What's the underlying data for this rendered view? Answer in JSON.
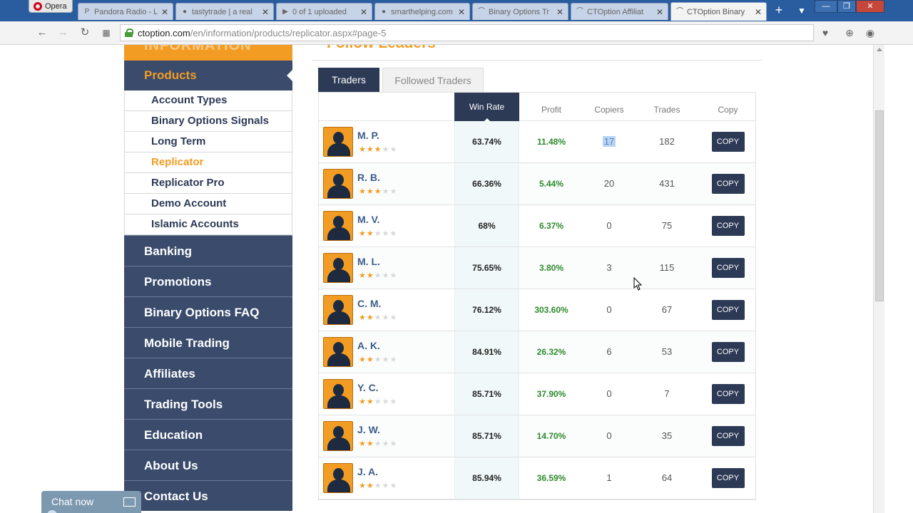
{
  "browser": {
    "menu_label": "Opera",
    "tabs": [
      {
        "label": "Pandora Radio - L",
        "icon": "P"
      },
      {
        "label": "tastytrade | a real",
        "icon": "●"
      },
      {
        "label": "0 of 1 uploaded",
        "icon": "▶"
      },
      {
        "label": "smarthelping.com",
        "icon": "●"
      },
      {
        "label": "Binary Options Tr",
        "icon": "⌒"
      },
      {
        "label": "CTOption Affiliat",
        "icon": "⌒"
      },
      {
        "label": "CTOption Binary",
        "icon": "⌒",
        "active": true
      }
    ],
    "url_domain": "ctoption.com",
    "url_path": "/en/information/products/replicator.aspx#page-5"
  },
  "sidebar": {
    "header": "INFORMATION",
    "products_label": "Products",
    "sub_items": [
      {
        "label": "Account Types"
      },
      {
        "label": "Binary Options Signals"
      },
      {
        "label": "Long Term"
      },
      {
        "label": "Replicator",
        "current": true
      },
      {
        "label": "Replicator Pro"
      },
      {
        "label": "Demo Account"
      },
      {
        "label": "Islamic Accounts"
      }
    ],
    "nav_items": [
      "Banking",
      "Promotions",
      "Binary Options FAQ",
      "Mobile Trading",
      "Affiliates",
      "Trading Tools",
      "Education",
      "About Us",
      "Contact Us"
    ]
  },
  "content": {
    "section_title": "Follow Leaders",
    "tabs": {
      "traders": "Traders",
      "followed": "Followed Traders"
    },
    "columns": {
      "win_rate": "Win Rate",
      "profit": "Profit",
      "copiers": "Copiers",
      "trades": "Trades",
      "copy": "Copy"
    },
    "copy_button": "COPY",
    "traders": [
      {
        "name": "M. P.",
        "stars": 3,
        "win_rate": "63.74%",
        "profit": "11.48%",
        "copiers": "17",
        "trades": "182",
        "selected_copiers": true
      },
      {
        "name": "R. B.",
        "stars": 3,
        "win_rate": "66.36%",
        "profit": "5.44%",
        "copiers": "20",
        "trades": "431"
      },
      {
        "name": "M. V.",
        "stars": 2,
        "win_rate": "68%",
        "profit": "6.37%",
        "copiers": "0",
        "trades": "75"
      },
      {
        "name": "M. L.",
        "stars": 2,
        "win_rate": "75.65%",
        "profit": "3.80%",
        "copiers": "3",
        "trades": "115"
      },
      {
        "name": "C. M.",
        "stars": 2,
        "win_rate": "76.12%",
        "profit": "303.60%",
        "copiers": "0",
        "trades": "67"
      },
      {
        "name": "A. K.",
        "stars": 2,
        "win_rate": "84.91%",
        "profit": "26.32%",
        "copiers": "6",
        "trades": "53"
      },
      {
        "name": "Y. C.",
        "stars": 2,
        "win_rate": "85.71%",
        "profit": "37.90%",
        "copiers": "0",
        "trades": "7"
      },
      {
        "name": "J. W.",
        "stars": 2,
        "win_rate": "85.71%",
        "profit": "14.70%",
        "copiers": "0",
        "trades": "35"
      },
      {
        "name": "J. A.",
        "stars": 2,
        "win_rate": "85.94%",
        "profit": "36.59%",
        "copiers": "1",
        "trades": "64"
      }
    ]
  },
  "chat": {
    "label": "Chat now"
  },
  "colors": {
    "accent": "#f39c23",
    "navy": "#3a4b6c",
    "profit_green": "#2d8a2d"
  }
}
